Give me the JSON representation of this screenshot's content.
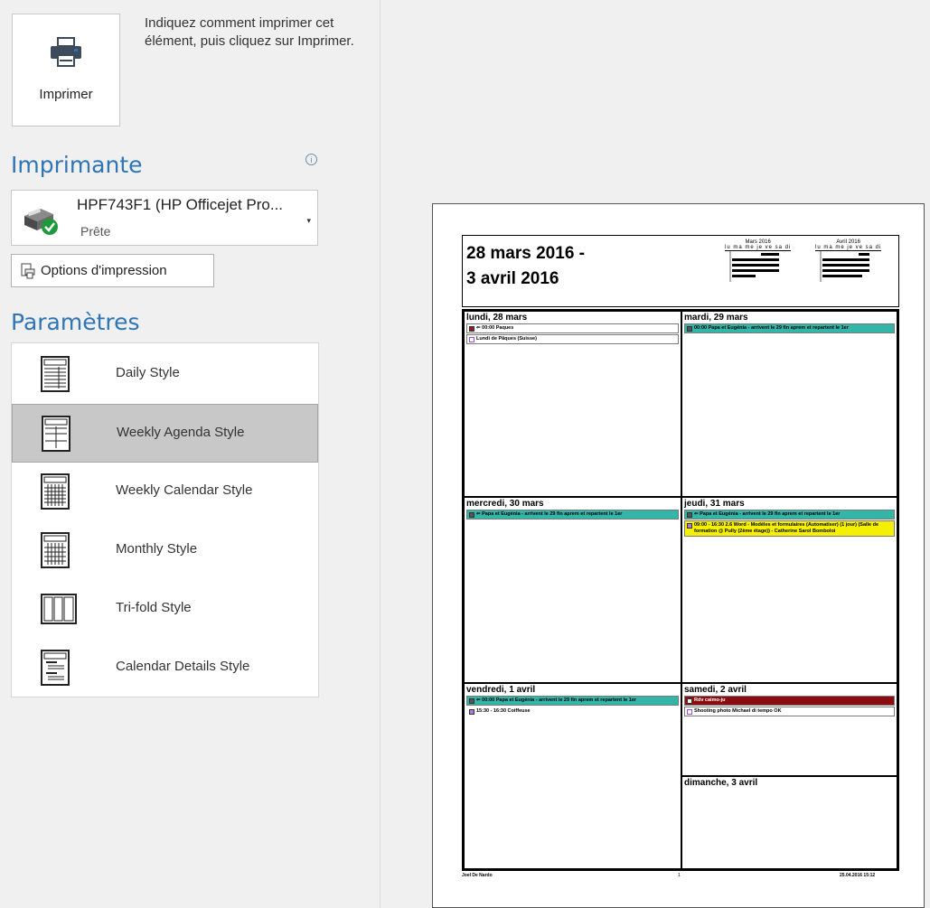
{
  "print": {
    "button_label": "Imprimer",
    "instructions": "Indiquez comment imprimer cet élément, puis cliquez sur Imprimer."
  },
  "printer": {
    "section_title": "Imprimante",
    "name": "HPF743F1 (HP Officejet Pro...",
    "status": "Prête",
    "options_label": "Options d'impression"
  },
  "settings": {
    "section_title": "Paramètres",
    "styles": [
      {
        "label": "Daily Style",
        "selected": false
      },
      {
        "label": "Weekly Agenda Style",
        "selected": true
      },
      {
        "label": "Weekly Calendar Style",
        "selected": false
      },
      {
        "label": "Monthly Style",
        "selected": false
      },
      {
        "label": "Tri-fold Style",
        "selected": false
      },
      {
        "label": "Calendar Details Style",
        "selected": false
      }
    ]
  },
  "preview": {
    "title_line1": "28 mars 2016 -",
    "title_line2": "3 avril 2016",
    "mini_cal_march": {
      "title": "Mars 2016",
      "dow": "lu ma me je ve sa di"
    },
    "mini_cal_april": {
      "title": "Avril 2016",
      "dow": "lu ma me je ve sa di"
    },
    "days": {
      "mon": {
        "label": "lundi, 28 mars",
        "ev1": "⇐ 00:00 Paques",
        "ev2": "Lundi de Pâques (Suisse)"
      },
      "tue": {
        "label": "mardi, 29 mars",
        "ev1": "00:00 Papa et Eugénia - arrivent le 29 fin aprem et repartent le 1er"
      },
      "wed": {
        "label": "mercredi, 30 mars",
        "ev1": "⇐ Papa et Eugénia - arrivent le 29 fin aprem et repartent le 1er"
      },
      "thu": {
        "label": "jeudi, 31 mars",
        "ev1": "⇐ Papa et Eugénia - arrivent le 29 fin aprem et repartent le 1er",
        "ev2": "09:00 - 16:30 2.6 Word - Modèles et formulaires (Automatiser) (1 jour) (Salle de formation @ Pully (2ème étage)) - Catherine Sarol Bomboloi"
      },
      "fri": {
        "label": "vendredi, 1 avril",
        "ev1": "⇐ 00:00 Papa et Eugénia - arrivent le 29 fin aprem et repartent le 1er",
        "ev2": "15:30 - 16:30 Coiffeuse"
      },
      "sat": {
        "label": "samedi, 2 avril",
        "ev1": "Rdv caimo-ju",
        "ev2": "Shooting photo Michael di tempo OK"
      },
      "sun": {
        "label": "dimanche, 3 avril"
      }
    },
    "footer_left": "Joel De Nardo",
    "footer_center": "1",
    "footer_right": "25.04.2016 15:12"
  }
}
